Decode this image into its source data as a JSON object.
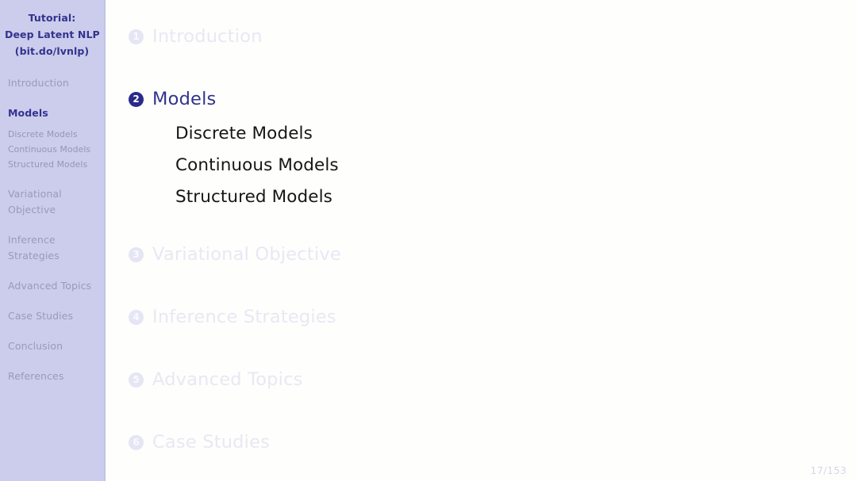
{
  "sidebar": {
    "title_lines": [
      "Tutorial:",
      "Deep Latent NLP",
      "(bit.do/lvnlp)"
    ],
    "items": [
      {
        "label": "Introduction",
        "active": false
      },
      {
        "label": "Models",
        "active": true
      },
      {
        "label": "Variational Objective",
        "active": false
      },
      {
        "label": "Inference Strategies",
        "active": false
      },
      {
        "label": "Advanced Topics",
        "active": false
      },
      {
        "label": "Case Studies",
        "active": false
      },
      {
        "label": "Conclusion",
        "active": false
      },
      {
        "label": "References",
        "active": false
      }
    ],
    "subitems": [
      "Discrete Models",
      "Continuous Models",
      "Structured Models"
    ],
    "variational_line1": "Variational",
    "variational_line2": "Objective",
    "inference_line1": "Inference",
    "inference_line2": "Strategies"
  },
  "outline": {
    "entries": [
      {
        "number": "1",
        "label": "Introduction",
        "active": false
      },
      {
        "number": "2",
        "label": "Models",
        "active": true
      },
      {
        "number": "3",
        "label": "Variational Objective",
        "active": false
      },
      {
        "number": "4",
        "label": "Inference Strategies",
        "active": false
      },
      {
        "number": "5",
        "label": "Advanced Topics",
        "active": false
      },
      {
        "number": "6",
        "label": "Case Studies",
        "active": false
      }
    ],
    "subsections": [
      "Discrete Models",
      "Continuous Models",
      "Structured Models"
    ]
  },
  "footer": {
    "page": "17/153"
  },
  "colors": {
    "sidebar_bg": "#ccccec",
    "accent": "#33338f",
    "active_badge": "#2a2a8c",
    "inactive_text": "#e8e8f5",
    "sidebar_inactive_text": "#9a9ab8",
    "subsection_text": "#161616",
    "page_number": "#d6d6ec",
    "main_bg": "#fefefc"
  }
}
